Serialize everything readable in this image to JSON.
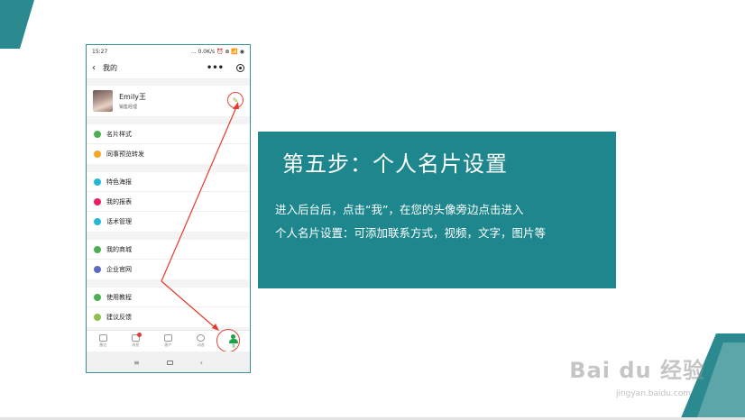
{
  "phone": {
    "status_time": "15:27",
    "status_right": "... 0.0K/s ⏰ ⋒ 📶 ◉",
    "nav_title": "我的",
    "back_symbol": "‹",
    "more_symbol": "•••",
    "profile": {
      "name": "Emily王",
      "role": "销售经理",
      "edit_symbol": "✎"
    },
    "groups": [
      [
        {
          "label": "名片样式",
          "color": "#4caf50"
        },
        {
          "label": "同事预览转发",
          "color": "#f5a623"
        }
      ],
      [
        {
          "label": "特色海报",
          "color": "#22b8d6"
        },
        {
          "label": "我的报表",
          "color": "#e91e63"
        },
        {
          "label": "话术管理",
          "color": "#22b8d6"
        }
      ],
      [
        {
          "label": "我的商城",
          "color": "#4caf50"
        },
        {
          "label": "企业官网",
          "color": "#5c6bc0"
        }
      ],
      [
        {
          "label": "使用教程",
          "color": "#4caf50"
        },
        {
          "label": "建议反馈",
          "color": "#8bc34a"
        }
      ]
    ],
    "tabs": [
      "雷达",
      "消息",
      "客户",
      "动态",
      "我"
    ],
    "sysnav": [
      "≡",
      "‹"
    ]
  },
  "panel": {
    "heading": "第五步：个人名片设置",
    "line1": "进入后台后，点击“我”，在您的头像旁边点击进入",
    "line2": "个人名片设置：可添加联系方式，视频，文字，图片等"
  },
  "watermark": {
    "main": "Bai du 经验",
    "sub": "jingyan.baidu.com"
  },
  "colors": {
    "teal": "#1e878d",
    "arrow": "#e53a2a",
    "active_tab": "#1aa34a"
  }
}
